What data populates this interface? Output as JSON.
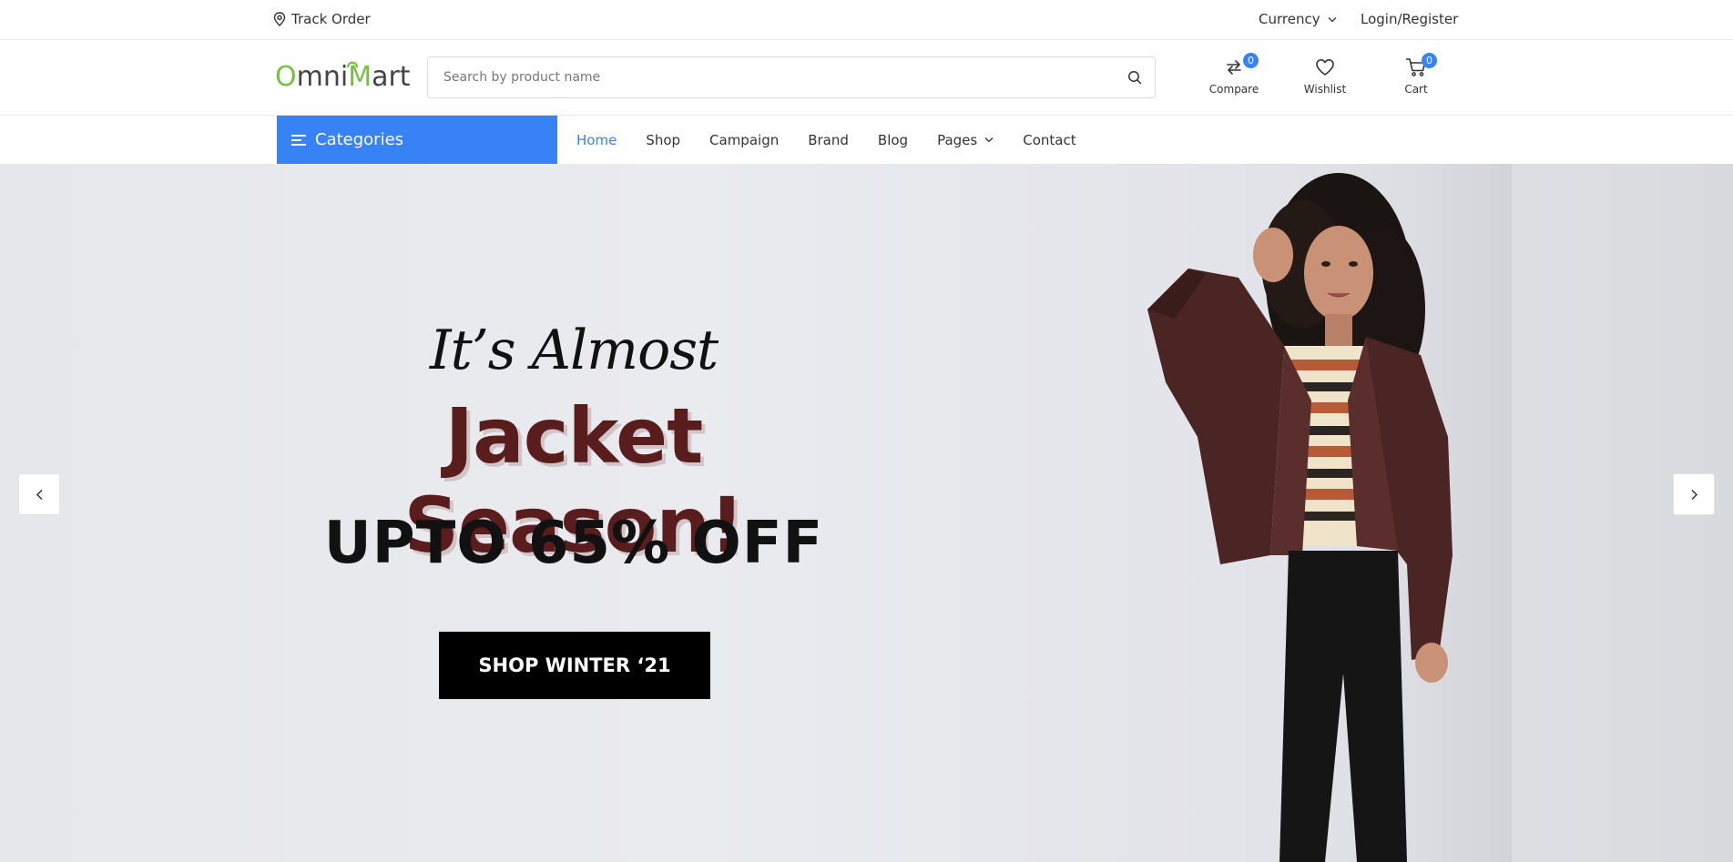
{
  "topbar": {
    "track_order": "Track Order",
    "currency": "Currency",
    "login_register": "Login/Register"
  },
  "header": {
    "logo": {
      "part1": "O",
      "part2": "mni",
      "part3": "M",
      "part4": "art"
    },
    "search": {
      "placeholder": "Search by product name",
      "value": ""
    },
    "compare": {
      "label": "Compare",
      "count": "0"
    },
    "wishlist": {
      "label": "Wishlist"
    },
    "cart": {
      "label": "Cart",
      "count": "0"
    }
  },
  "nav": {
    "categories": "Categories",
    "items": [
      {
        "label": "Home",
        "active": true
      },
      {
        "label": "Shop"
      },
      {
        "label": "Campaign"
      },
      {
        "label": "Brand"
      },
      {
        "label": "Blog"
      },
      {
        "label": "Pages",
        "dropdown": true
      },
      {
        "label": "Contact"
      }
    ]
  },
  "hero": {
    "line1": "It’s Almost",
    "line2": "Jacket Season!",
    "line3": "UPTO 65% OFF",
    "button": "SHOP WINTER ‘21"
  },
  "colors": {
    "accent": "#3783f5",
    "logo_green": "#76c043",
    "headline_maroon": "#5a1d1d"
  },
  "icons": [
    "location-pin-icon",
    "chevron-down-icon",
    "search-icon",
    "compare-icon",
    "heart-icon",
    "cart-icon",
    "menu-lines-icon",
    "chevron-left-icon",
    "chevron-right-icon"
  ]
}
